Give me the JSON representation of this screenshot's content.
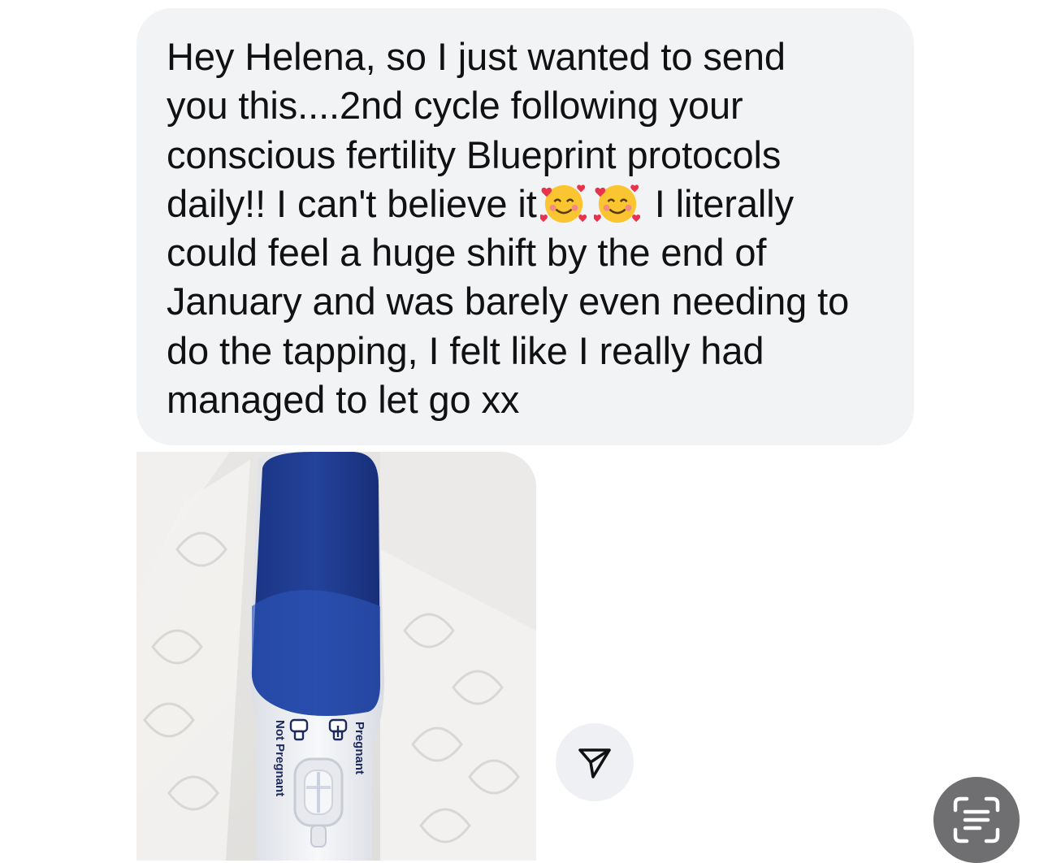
{
  "message": {
    "line1": "Hey Helena, so I just wanted to send",
    "line2": "you this....2nd cycle following your",
    "line3": "conscious fertility Blueprint protocols",
    "line4_before": "daily!! I can't believe it",
    "line4_after": "I literally",
    "line5": "could feel a huge shift by the end of",
    "line6": "January and was barely even needing to",
    "line7": "do the tapping, I felt like I really had",
    "line8": "managed to let go xx",
    "emoji_names": [
      "smiling-face-with-hearts-icon",
      "smiling-face-with-hearts-icon"
    ]
  },
  "photo": {
    "label_pregnant": "Pregnant",
    "label_not_pregnant": "Not Pregnant"
  },
  "actions": {
    "share_icon": "paper-plane-icon",
    "scan_icon": "text-scan-icon"
  },
  "colors": {
    "bubble": "#f2f3f5",
    "test_blue": "#1f3b8c",
    "scan_button": "#6f6f71"
  }
}
